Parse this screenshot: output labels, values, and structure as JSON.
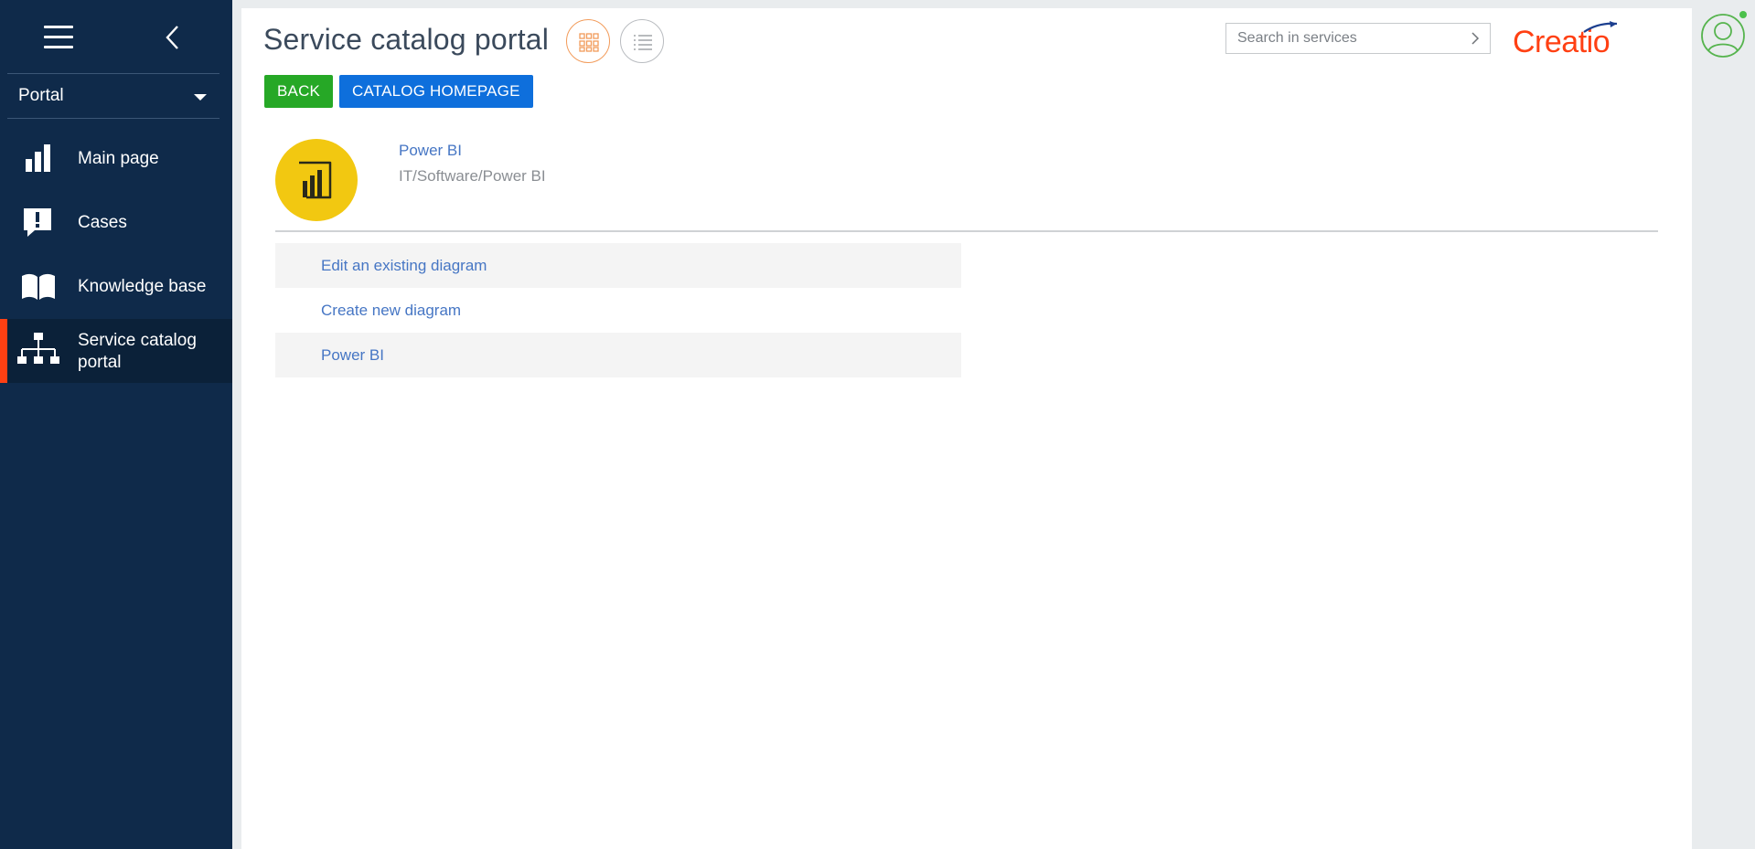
{
  "sidebar": {
    "portal_label": "Portal",
    "items": [
      {
        "label": "Main page",
        "icon": "bar-chart-icon",
        "active": false
      },
      {
        "label": "Cases",
        "icon": "chat-exclamation-icon",
        "active": false
      },
      {
        "label": "Knowledge base",
        "icon": "book-icon",
        "active": false
      },
      {
        "label": "Service catalog portal",
        "icon": "hierarchy-icon",
        "active": true
      }
    ],
    "accent_color": "#ff4013",
    "background_color": "#0f2a4a"
  },
  "header": {
    "title": "Service catalog portal",
    "search_placeholder": "Search in services",
    "brand": "Creatio",
    "brand_color": "#ff4013"
  },
  "toolbar": {
    "back_label": "BACK",
    "home_label": "CATALOG HOMEPAGE",
    "back_color": "#26a826",
    "home_color": "#0e6fdc"
  },
  "service": {
    "name": "Power BI",
    "path": "IT/Software/Power BI",
    "icon": "power-bi-icon",
    "icon_bg": "#f2c811"
  },
  "service_items": [
    {
      "label": "Edit an existing diagram"
    },
    {
      "label": "Create new diagram"
    },
    {
      "label": "Power BI"
    }
  ]
}
